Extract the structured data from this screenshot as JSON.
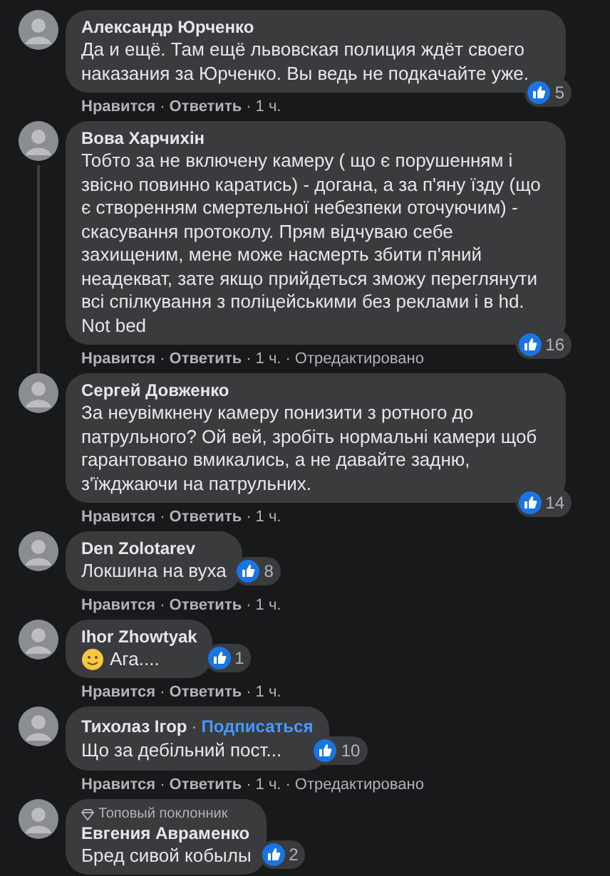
{
  "separator": "·",
  "comments": [
    {
      "author": "Александр Юрченко",
      "text": "Да и ещё. Там ещё львовская полиция ждёт своего наказания за Юрченко. Вы ведь не подкачайте уже.",
      "likes": "5",
      "kind": "overlap",
      "actions": [
        "Нравится",
        "Ответить",
        "1 ч."
      ]
    },
    {
      "author": "Вова Харчихін",
      "text": "Тобто за не включену камеру ( що є порушенням і звісно повинно каратись) - догана, а за п'яну їзду (що є створенням смертельної небезпеки оточуючим) - скасування протоколу. Прям відчуваю себе захищеним, мене може насмерть збити п'яний неадекват, зате якщо прийдеться зможу переглянути всі спілкування з поліцейськими без реклами і в hd. Not bed",
      "likes": "16",
      "kind": "overlap",
      "actions": [
        "Нравится",
        "Ответить",
        "1 ч.",
        "Отредактировано"
      ],
      "thread": true
    },
    {
      "author": "Сергей Довженко",
      "text": "За неувімкнену камеру понизити з ротного до патрульного? Ой вей, зробіть нормальні камери щоб гарантовано вмикались, а не давайте задню, з'їжджаючи на патрульних.",
      "likes": "14",
      "kind": "overlap",
      "actions": [
        "Нравится",
        "Ответить",
        "1 ч."
      ]
    },
    {
      "author": "Den Zolotarev",
      "text": "Локшина на вуха",
      "likes": "8",
      "kind": "inline",
      "actions": [
        "Нравится",
        "Ответить",
        "1 ч."
      ]
    },
    {
      "author": "Ihor Zhowtyak",
      "emoji": true,
      "text": "Ага....",
      "likes": "1",
      "kind": "inline",
      "actions": [
        "Нравится",
        "Ответить",
        "1 ч."
      ]
    },
    {
      "author": "Тихолаз Ігор",
      "follow": "Подписаться",
      "text": "Що за дебільний пост...",
      "likes": "10",
      "kind": "inline",
      "actions": [
        "Нравится",
        "Ответить",
        "1 ч.",
        "Отредактировано"
      ]
    },
    {
      "author": "Евгения Авраменко",
      "badge": "Топовый поклонник",
      "text": "Бред сивой кобылы",
      "likes": "2",
      "kind": "inline"
    }
  ]
}
